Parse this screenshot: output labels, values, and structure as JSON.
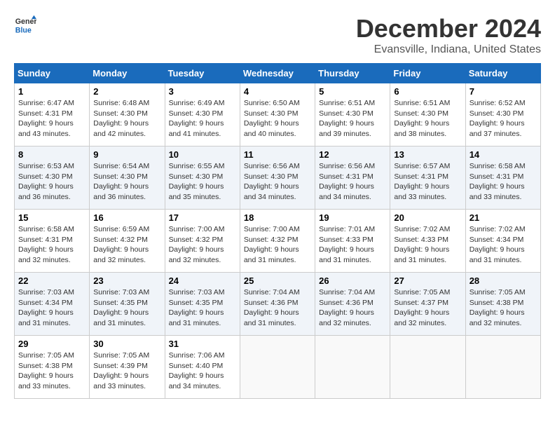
{
  "header": {
    "logo_line1": "General",
    "logo_line2": "Blue",
    "title": "December 2024",
    "subtitle": "Evansville, Indiana, United States"
  },
  "weekdays": [
    "Sunday",
    "Monday",
    "Tuesday",
    "Wednesday",
    "Thursday",
    "Friday",
    "Saturday"
  ],
  "weeks": [
    [
      {
        "day": "1",
        "sunrise": "Sunrise: 6:47 AM",
        "sunset": "Sunset: 4:31 PM",
        "daylight": "Daylight: 9 hours and 43 minutes."
      },
      {
        "day": "2",
        "sunrise": "Sunrise: 6:48 AM",
        "sunset": "Sunset: 4:30 PM",
        "daylight": "Daylight: 9 hours and 42 minutes."
      },
      {
        "day": "3",
        "sunrise": "Sunrise: 6:49 AM",
        "sunset": "Sunset: 4:30 PM",
        "daylight": "Daylight: 9 hours and 41 minutes."
      },
      {
        "day": "4",
        "sunrise": "Sunrise: 6:50 AM",
        "sunset": "Sunset: 4:30 PM",
        "daylight": "Daylight: 9 hours and 40 minutes."
      },
      {
        "day": "5",
        "sunrise": "Sunrise: 6:51 AM",
        "sunset": "Sunset: 4:30 PM",
        "daylight": "Daylight: 9 hours and 39 minutes."
      },
      {
        "day": "6",
        "sunrise": "Sunrise: 6:51 AM",
        "sunset": "Sunset: 4:30 PM",
        "daylight": "Daylight: 9 hours and 38 minutes."
      },
      {
        "day": "7",
        "sunrise": "Sunrise: 6:52 AM",
        "sunset": "Sunset: 4:30 PM",
        "daylight": "Daylight: 9 hours and 37 minutes."
      }
    ],
    [
      {
        "day": "8",
        "sunrise": "Sunrise: 6:53 AM",
        "sunset": "Sunset: 4:30 PM",
        "daylight": "Daylight: 9 hours and 36 minutes."
      },
      {
        "day": "9",
        "sunrise": "Sunrise: 6:54 AM",
        "sunset": "Sunset: 4:30 PM",
        "daylight": "Daylight: 9 hours and 36 minutes."
      },
      {
        "day": "10",
        "sunrise": "Sunrise: 6:55 AM",
        "sunset": "Sunset: 4:30 PM",
        "daylight": "Daylight: 9 hours and 35 minutes."
      },
      {
        "day": "11",
        "sunrise": "Sunrise: 6:56 AM",
        "sunset": "Sunset: 4:30 PM",
        "daylight": "Daylight: 9 hours and 34 minutes."
      },
      {
        "day": "12",
        "sunrise": "Sunrise: 6:56 AM",
        "sunset": "Sunset: 4:31 PM",
        "daylight": "Daylight: 9 hours and 34 minutes."
      },
      {
        "day": "13",
        "sunrise": "Sunrise: 6:57 AM",
        "sunset": "Sunset: 4:31 PM",
        "daylight": "Daylight: 9 hours and 33 minutes."
      },
      {
        "day": "14",
        "sunrise": "Sunrise: 6:58 AM",
        "sunset": "Sunset: 4:31 PM",
        "daylight": "Daylight: 9 hours and 33 minutes."
      }
    ],
    [
      {
        "day": "15",
        "sunrise": "Sunrise: 6:58 AM",
        "sunset": "Sunset: 4:31 PM",
        "daylight": "Daylight: 9 hours and 32 minutes."
      },
      {
        "day": "16",
        "sunrise": "Sunrise: 6:59 AM",
        "sunset": "Sunset: 4:32 PM",
        "daylight": "Daylight: 9 hours and 32 minutes."
      },
      {
        "day": "17",
        "sunrise": "Sunrise: 7:00 AM",
        "sunset": "Sunset: 4:32 PM",
        "daylight": "Daylight: 9 hours and 32 minutes."
      },
      {
        "day": "18",
        "sunrise": "Sunrise: 7:00 AM",
        "sunset": "Sunset: 4:32 PM",
        "daylight": "Daylight: 9 hours and 31 minutes."
      },
      {
        "day": "19",
        "sunrise": "Sunrise: 7:01 AM",
        "sunset": "Sunset: 4:33 PM",
        "daylight": "Daylight: 9 hours and 31 minutes."
      },
      {
        "day": "20",
        "sunrise": "Sunrise: 7:02 AM",
        "sunset": "Sunset: 4:33 PM",
        "daylight": "Daylight: 9 hours and 31 minutes."
      },
      {
        "day": "21",
        "sunrise": "Sunrise: 7:02 AM",
        "sunset": "Sunset: 4:34 PM",
        "daylight": "Daylight: 9 hours and 31 minutes."
      }
    ],
    [
      {
        "day": "22",
        "sunrise": "Sunrise: 7:03 AM",
        "sunset": "Sunset: 4:34 PM",
        "daylight": "Daylight: 9 hours and 31 minutes."
      },
      {
        "day": "23",
        "sunrise": "Sunrise: 7:03 AM",
        "sunset": "Sunset: 4:35 PM",
        "daylight": "Daylight: 9 hours and 31 minutes."
      },
      {
        "day": "24",
        "sunrise": "Sunrise: 7:03 AM",
        "sunset": "Sunset: 4:35 PM",
        "daylight": "Daylight: 9 hours and 31 minutes."
      },
      {
        "day": "25",
        "sunrise": "Sunrise: 7:04 AM",
        "sunset": "Sunset: 4:36 PM",
        "daylight": "Daylight: 9 hours and 31 minutes."
      },
      {
        "day": "26",
        "sunrise": "Sunrise: 7:04 AM",
        "sunset": "Sunset: 4:36 PM",
        "daylight": "Daylight: 9 hours and 32 minutes."
      },
      {
        "day": "27",
        "sunrise": "Sunrise: 7:05 AM",
        "sunset": "Sunset: 4:37 PM",
        "daylight": "Daylight: 9 hours and 32 minutes."
      },
      {
        "day": "28",
        "sunrise": "Sunrise: 7:05 AM",
        "sunset": "Sunset: 4:38 PM",
        "daylight": "Daylight: 9 hours and 32 minutes."
      }
    ],
    [
      {
        "day": "29",
        "sunrise": "Sunrise: 7:05 AM",
        "sunset": "Sunset: 4:38 PM",
        "daylight": "Daylight: 9 hours and 33 minutes."
      },
      {
        "day": "30",
        "sunrise": "Sunrise: 7:05 AM",
        "sunset": "Sunset: 4:39 PM",
        "daylight": "Daylight: 9 hours and 33 minutes."
      },
      {
        "day": "31",
        "sunrise": "Sunrise: 7:06 AM",
        "sunset": "Sunset: 4:40 PM",
        "daylight": "Daylight: 9 hours and 34 minutes."
      },
      null,
      null,
      null,
      null
    ]
  ]
}
